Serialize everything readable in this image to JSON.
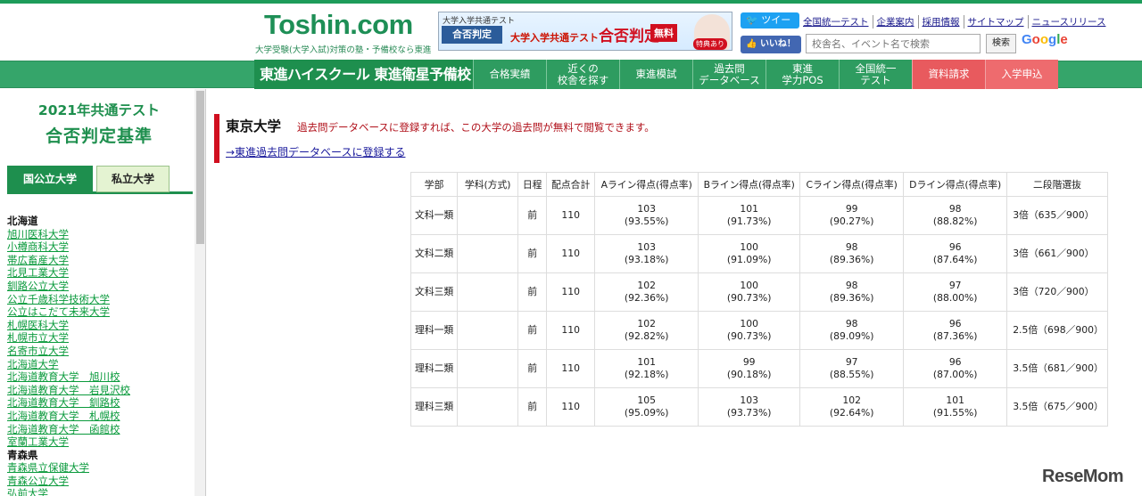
{
  "header": {
    "logo": "Toshin.com",
    "tagline": "大学受験(大学入試)対策の塾・予備校なら東進",
    "banner": {
      "small": "大学入学共通テスト",
      "box": "合否判定",
      "mid_prefix": "大学入学共通テスト",
      "mid_big": "合否判定",
      "free": "無料",
      "tokuten": "特典あり"
    },
    "twitter_label": "ツイート",
    "facebook_label": "いいね！",
    "links": [
      "全国統一テスト",
      "企業案内",
      "採用情報",
      "サイトマップ",
      "ニュースリリース"
    ],
    "search_placeholder": "校舎名、イベント名で検索",
    "search_button": "検索",
    "google": [
      "G",
      "o",
      "o",
      "g",
      "l",
      "e"
    ]
  },
  "nav": {
    "brand": "東進ハイスクール 東進衛星予備校",
    "items": [
      {
        "label": "合格実績",
        "style": "normal"
      },
      {
        "label": "近くの\n校舎を探す",
        "style": "normal"
      },
      {
        "label": "東進模試",
        "style": "normal"
      },
      {
        "label": "過去問\nデータベース",
        "style": "normal"
      },
      {
        "label": "東進\n学力POS",
        "style": "normal"
      },
      {
        "label": "全国統一\nテスト",
        "style": "normal"
      },
      {
        "label": "資料請求",
        "style": "red"
      },
      {
        "label": "入学申込",
        "style": "red2"
      }
    ]
  },
  "sidebar": {
    "title_line1": "2021年共通テスト",
    "title_line2": "合否判定基準",
    "tab_national": "国公立大学",
    "tab_private": "私立大学",
    "list": [
      {
        "type": "pref",
        "name": "北海道"
      },
      {
        "type": "uni",
        "name": "旭川医科大学"
      },
      {
        "type": "uni",
        "name": "小樽商科大学"
      },
      {
        "type": "uni",
        "name": "帯広畜産大学"
      },
      {
        "type": "uni",
        "name": "北見工業大学"
      },
      {
        "type": "uni",
        "name": "釧路公立大学"
      },
      {
        "type": "uni",
        "name": "公立千歳科学技術大学"
      },
      {
        "type": "uni",
        "name": "公立はこだて未来大学"
      },
      {
        "type": "uni",
        "name": "札幌医科大学"
      },
      {
        "type": "uni",
        "name": "札幌市立大学"
      },
      {
        "type": "uni",
        "name": "名寄市立大学"
      },
      {
        "type": "uni",
        "name": "北海道大学"
      },
      {
        "type": "uni",
        "name": "北海道教育大学　旭川校"
      },
      {
        "type": "uni",
        "name": "北海道教育大学　岩見沢校"
      },
      {
        "type": "uni",
        "name": "北海道教育大学　釧路校"
      },
      {
        "type": "uni",
        "name": "北海道教育大学　札幌校"
      },
      {
        "type": "uni",
        "name": "北海道教育大学　函館校"
      },
      {
        "type": "uni",
        "name": "室蘭工業大学"
      },
      {
        "type": "pref",
        "name": "青森県"
      },
      {
        "type": "uni",
        "name": "青森県立保健大学"
      },
      {
        "type": "uni",
        "name": "青森公立大学"
      },
      {
        "type": "uni",
        "name": "弘前大学"
      }
    ]
  },
  "main": {
    "university": "東京大学",
    "notice": "過去問データベースに登録すれば、この大学の過去問が無料で閲覧できます。",
    "register_link": "→東進過去問データベースに登録する",
    "table": {
      "headers": [
        "学部",
        "学科(方式)",
        "日程",
        "配点合計",
        "Aライン得点(得点率)",
        "Bライン得点(得点率)",
        "Cライン得点(得点率)",
        "Dライン得点(得点率)",
        "二段階選抜"
      ],
      "rows": [
        {
          "faculty": "文科一類",
          "dept": "",
          "schedule": "前",
          "total": "110",
          "a": "103",
          "a_rate": "(93.55%)",
          "b": "101",
          "b_rate": "(91.73%)",
          "c": "99",
          "c_rate": "(90.27%)",
          "d": "98",
          "d_rate": "(88.82%)",
          "two": "3倍（635／900）"
        },
        {
          "faculty": "文科二類",
          "dept": "",
          "schedule": "前",
          "total": "110",
          "a": "103",
          "a_rate": "(93.18%)",
          "b": "100",
          "b_rate": "(91.09%)",
          "c": "98",
          "c_rate": "(89.36%)",
          "d": "96",
          "d_rate": "(87.64%)",
          "two": "3倍（661／900）"
        },
        {
          "faculty": "文科三類",
          "dept": "",
          "schedule": "前",
          "total": "110",
          "a": "102",
          "a_rate": "(92.36%)",
          "b": "100",
          "b_rate": "(90.73%)",
          "c": "98",
          "c_rate": "(89.36%)",
          "d": "97",
          "d_rate": "(88.00%)",
          "two": "3倍（720／900）"
        },
        {
          "faculty": "理科一類",
          "dept": "",
          "schedule": "前",
          "total": "110",
          "a": "102",
          "a_rate": "(92.82%)",
          "b": "100",
          "b_rate": "(90.73%)",
          "c": "98",
          "c_rate": "(89.09%)",
          "d": "96",
          "d_rate": "(87.36%)",
          "two": "2.5倍（698／900）"
        },
        {
          "faculty": "理科二類",
          "dept": "",
          "schedule": "前",
          "total": "110",
          "a": "101",
          "a_rate": "(92.18%)",
          "b": "99",
          "b_rate": "(90.18%)",
          "c": "97",
          "c_rate": "(88.55%)",
          "d": "96",
          "d_rate": "(87.00%)",
          "two": "3.5倍（681／900）"
        },
        {
          "faculty": "理科三類",
          "dept": "",
          "schedule": "前",
          "total": "110",
          "a": "105",
          "a_rate": "(95.09%)",
          "b": "103",
          "b_rate": "(93.73%)",
          "c": "102",
          "c_rate": "(92.64%)",
          "d": "101",
          "d_rate": "(91.55%)",
          "two": "3.5倍（675／900）"
        }
      ]
    }
  },
  "watermark": "ReseMom"
}
